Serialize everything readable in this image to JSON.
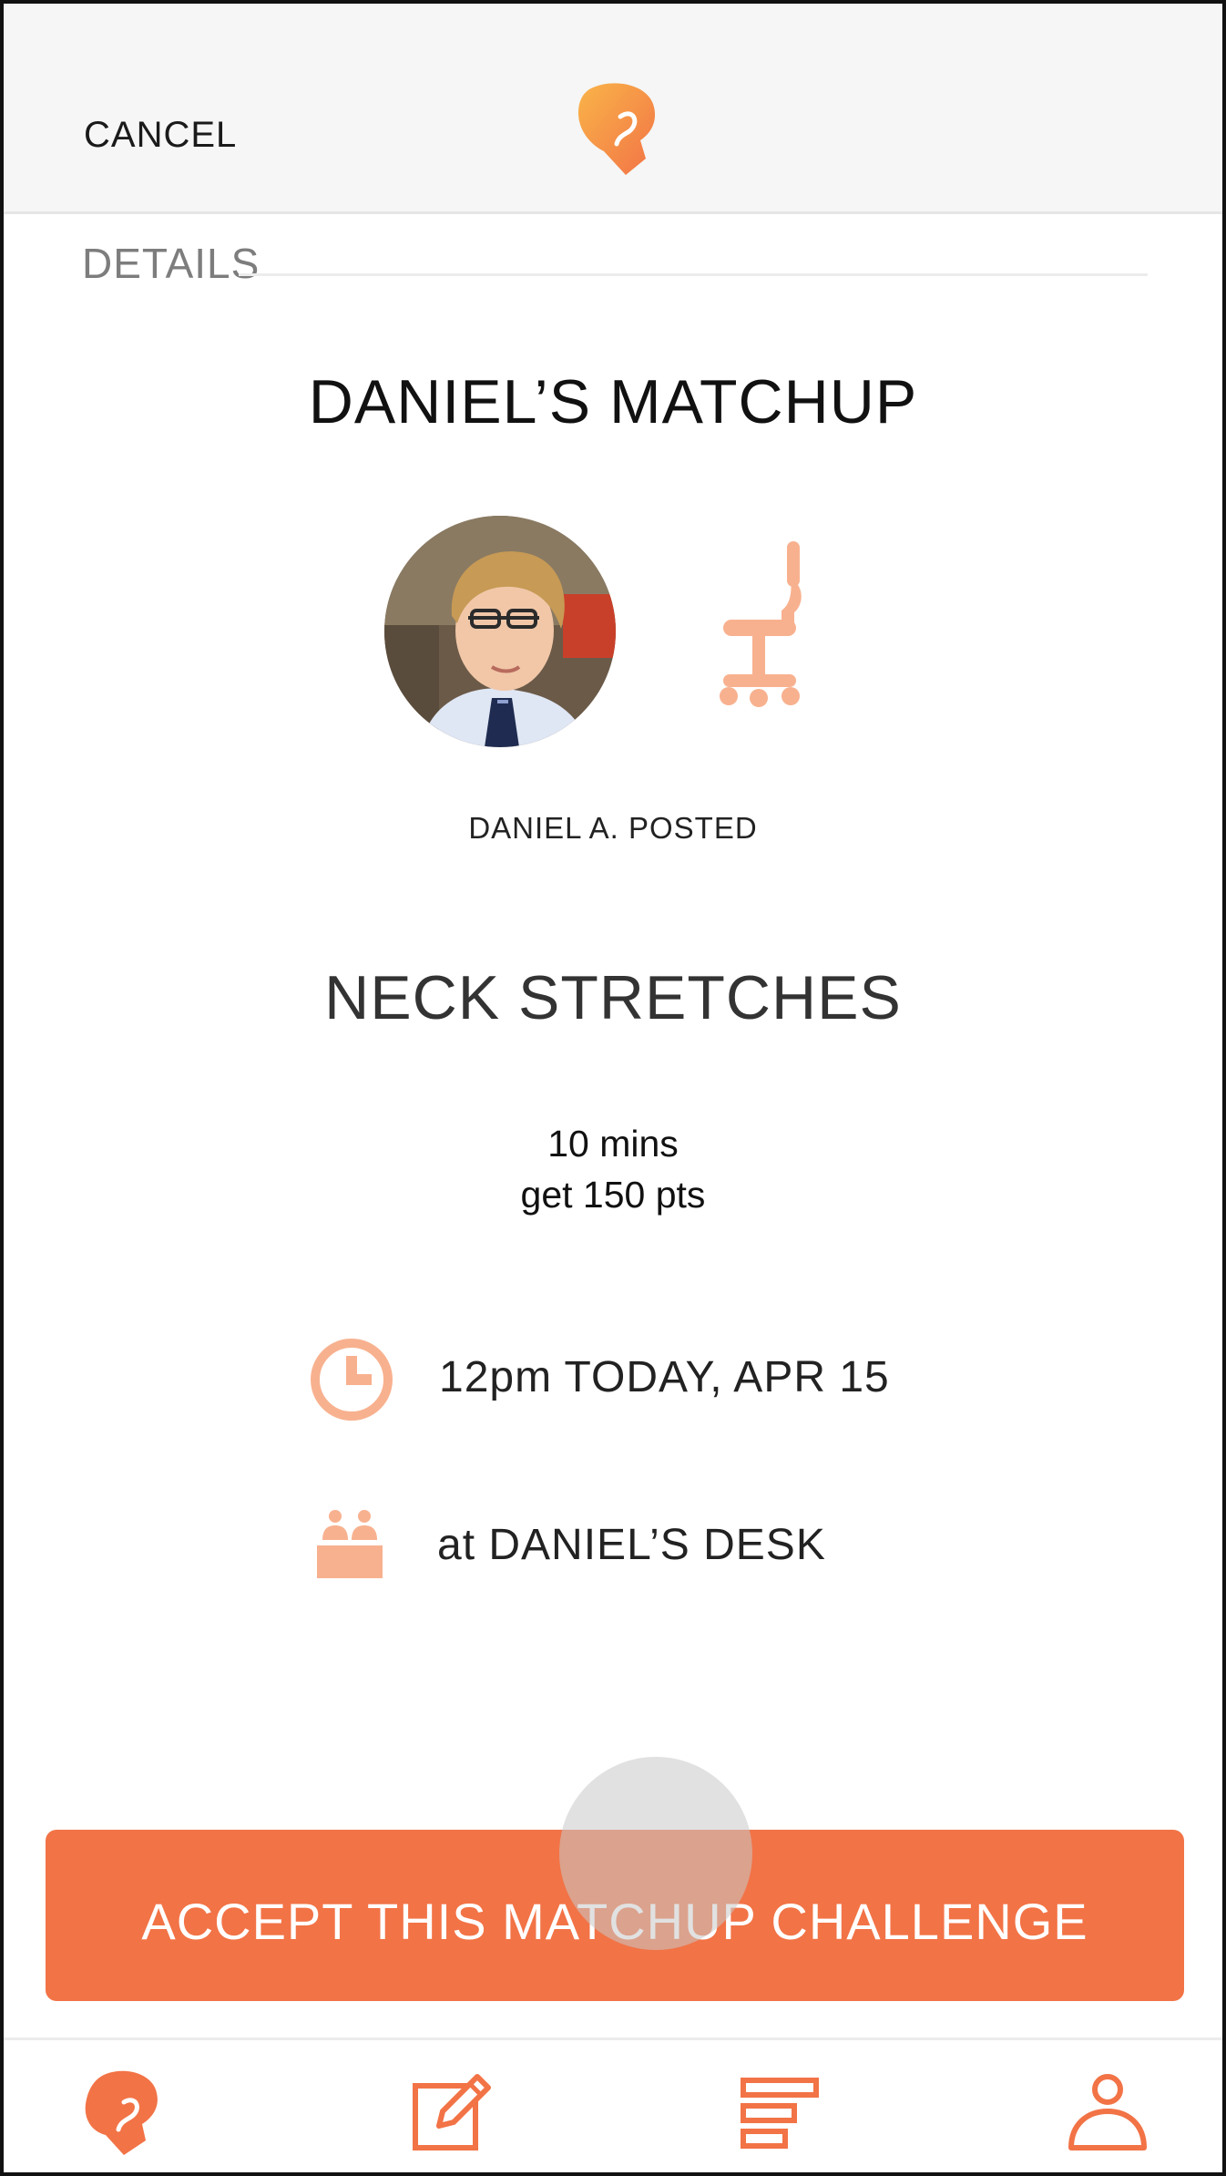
{
  "header": {
    "cancel_label": "CANCEL",
    "logo_icon": "boxing-glove-icon"
  },
  "section": {
    "title": "DETAILS"
  },
  "matchup": {
    "title": "DANIEL’S MATCHUP",
    "avatar": "user-avatar-daniel",
    "category_icon": "office-chair-icon",
    "posted_by": "DANIEL A. POSTED",
    "activity": "NECK STRETCHES",
    "duration": "10 mins",
    "points": "get 150 pts",
    "time": {
      "icon": "clock-icon",
      "text": "12pm TODAY, APR 15"
    },
    "place": {
      "icon": "desk-icon",
      "text": "at DANIEL’S DESK"
    }
  },
  "accept_button": {
    "label": "ACCEPT THIS MATCHUP CHALLENGE"
  },
  "tabbar": {
    "items": [
      {
        "icon": "boxing-glove-icon",
        "active": true
      },
      {
        "icon": "edit-icon",
        "active": false
      },
      {
        "icon": "leaderboard-icon",
        "active": false
      },
      {
        "icon": "profile-icon",
        "active": false
      }
    ]
  },
  "colors": {
    "accent": "#f27346",
    "accent_light": "#f8b18f",
    "header_bg": "#f5f6f5",
    "muted_text": "#7d7d7d"
  }
}
